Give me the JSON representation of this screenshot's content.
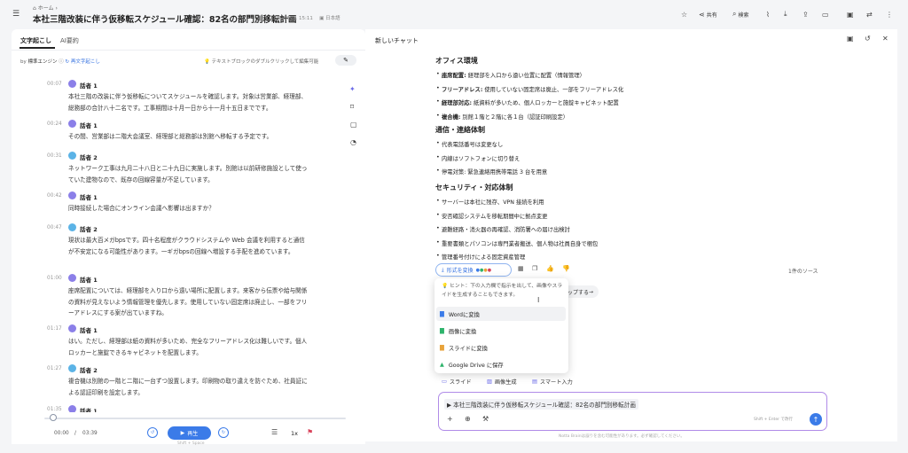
{
  "breadcrumb": "ホーム",
  "doc_title": "本社三階改装に伴う仮移転スケジュール確認：82名の部門別移転計画",
  "doc_meta": {
    "date": "2026/07/31 15:11",
    "language": "日本語"
  },
  "toolbar": {
    "share": "共有",
    "search": "検索"
  },
  "left_tabs": [
    "文字起こし",
    "AI要約"
  ],
  "speaker_row": {
    "by": "by",
    "engine": "標準エンジン",
    "regen": "再文字起こし"
  },
  "edit_hint": "テキストブロックのダブルクリックして編集可能",
  "segments": [
    {
      "time": "00:07",
      "speaker": "話者 1",
      "text": "本社三階の改装に伴う仮移転についてスケジュールを確認します。対象は営業部、経理部、総務部の合計八十二名です。工事期間は十月一日から十一月十五日までです。"
    },
    {
      "time": "00:24",
      "speaker": "話者 1",
      "text": "その間、営業部は二階大会議室、経理部と総務部は別館へ移転する予定です。"
    },
    {
      "time": "00:31",
      "speaker": "話者 2",
      "text": "ネットワーク工事は九月二十八日と二十九日に実施します。別館は以前研修施設として使っていた建物なので、既存の回線容量が不足しています。"
    },
    {
      "time": "00:42",
      "speaker": "話者 1",
      "text": "同時接続した場合にオンライン会議へ影響は出ますか？"
    },
    {
      "time": "00:47",
      "speaker": "話者 2",
      "text": "現状は最大百メガbpsです。四十名程度がクラウドシステムや Web 会議を利用すると通信が不安定になる可能性があります。一ギガbpsの回線へ増設する手配を進めています。"
    },
    {
      "time": "01:00",
      "speaker": "話者 1",
      "text": "座席配置については、経理部を入り口から遠い場所に配置します。来客から伝票や給与関係の資料が見えないよう情報管理を優先します。使用していない固定席は廃止し、一部をフリーアドレスにする案が出ていますね。"
    },
    {
      "time": "01:17",
      "speaker": "話者 1",
      "text": "はい。ただし、経理部は紙の資料が多いため、完全なフリーアドレス化は難しいです。個人ロッカーと施錠できるキャビネットを配置します。"
    },
    {
      "time": "01:27",
      "speaker": "話者 2",
      "text": "複合機は別館の一階と二階に一台ずつ設置します。印刷物の取り違えを防ぐため、社員証による認証印刷を設定します。"
    },
    {
      "time": "01:35",
      "speaker": "話者 1",
      "text": ""
    }
  ],
  "player": {
    "current": "00:00",
    "total": "03:39",
    "play_label": "再生",
    "play_hint": "Shift + Space",
    "speed": "1x"
  },
  "chat": {
    "title": "新しいチャット",
    "sections": [
      {
        "heading": "オフィス環境",
        "items": [
          {
            "bold": "座席配置:",
            "text": " 経理部を入口から遠い位置に配置（情報管理）"
          },
          {
            "bold": "フリーアドレス:",
            "text": " 使用していない固定席は廃止、一部をフリーアドレス化"
          },
          {
            "bold": "経理部対応:",
            "text": " 紙資料が多いため、個人ロッカーと施錠キャビネット配置"
          },
          {
            "bold": "複合機:",
            "text": " 別館１階と２階に各１台（認証印刷設定）"
          }
        ]
      },
      {
        "heading": "通信・連絡体制",
        "items": [
          {
            "bold": "",
            "text": "代表電話番号は変更なし"
          },
          {
            "bold": "",
            "text": "内線はソフトフォンに切り替え"
          },
          {
            "bold": "",
            "text": "停電対策: 緊急連絡用携帯電話 3 台を用意"
          }
        ]
      },
      {
        "heading": "セキュリティ・対応体制",
        "items": [
          {
            "bold": "",
            "text": "サーバーは本社に残存、VPN 接続を利用"
          },
          {
            "bold": "",
            "text": "安否確認システムを移転期間中に拠点変更"
          },
          {
            "bold": "",
            "text": "避難経路・消火器の再確認、消防署への届け出検討"
          },
          {
            "bold": "",
            "text": "重要書類とパソコンは専門業者搬送、個人物は社員自身で梱包"
          },
          {
            "bold": "",
            "text": "管理番号付けによる固定資産管理"
          }
        ]
      }
    ],
    "convert_label": "形式を変換",
    "sources": "1件のソース",
    "step_label": "ップする",
    "menu": {
      "hint": "ヒント：下の入力欄で指示を出して、画像やスライドを生成することもできます。",
      "items": [
        "Wordに変換",
        "画像に変換",
        "スライドに変換",
        "Google Drive に保存"
      ]
    },
    "chips": [
      "スライド",
      "画像生成",
      "スマート入力"
    ],
    "input_value": "本社三階改装に伴う仮移転スケジュール確認：82名の部門別移転計画",
    "send_hint": "Shift + Enter で改行",
    "footer_note": "Notta Brainは誤りを含む可能性があります。必ず確認してください。"
  },
  "colors": {
    "accent": "#3b7be8",
    "speaker1": "#8b7fe8",
    "speaker2": "#5bb3e6"
  }
}
